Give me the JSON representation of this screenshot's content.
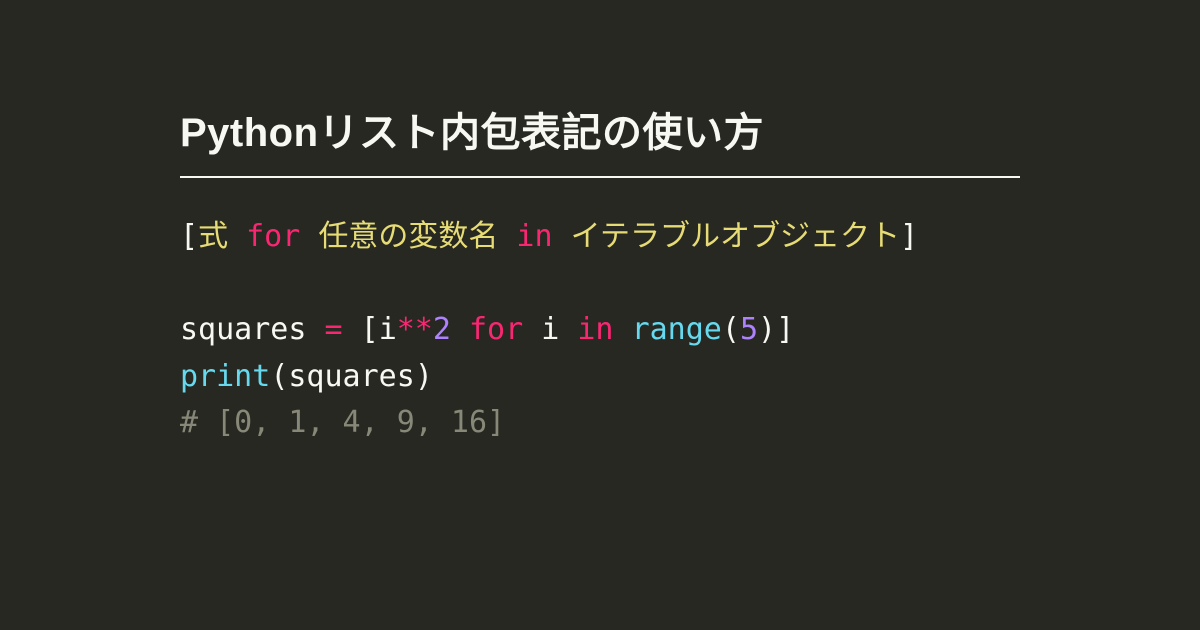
{
  "title": "Pythonリスト内包表記の使い方",
  "syntax": {
    "lbr": "[",
    "expr": "式",
    "for": " for ",
    "var": "任意の変数名",
    "in": " in ",
    "iter": "イテラブルオブジェクト",
    "rbr": "]"
  },
  "code": {
    "line1": {
      "a": "squares ",
      "eq": "= ",
      "lbr": "[",
      "i1": "i",
      "pow": "**",
      "n2": "2",
      "for": " for ",
      "i2": "i",
      "in": " in ",
      "range": "range",
      "lp": "(",
      "n5": "5",
      "rp": ")",
      "rbr": "]"
    },
    "line2": {
      "print": "print",
      "lp": "(",
      "arg": "squares",
      "rp": ")"
    },
    "line3": "# [0, 1, 4, 9, 16]"
  }
}
